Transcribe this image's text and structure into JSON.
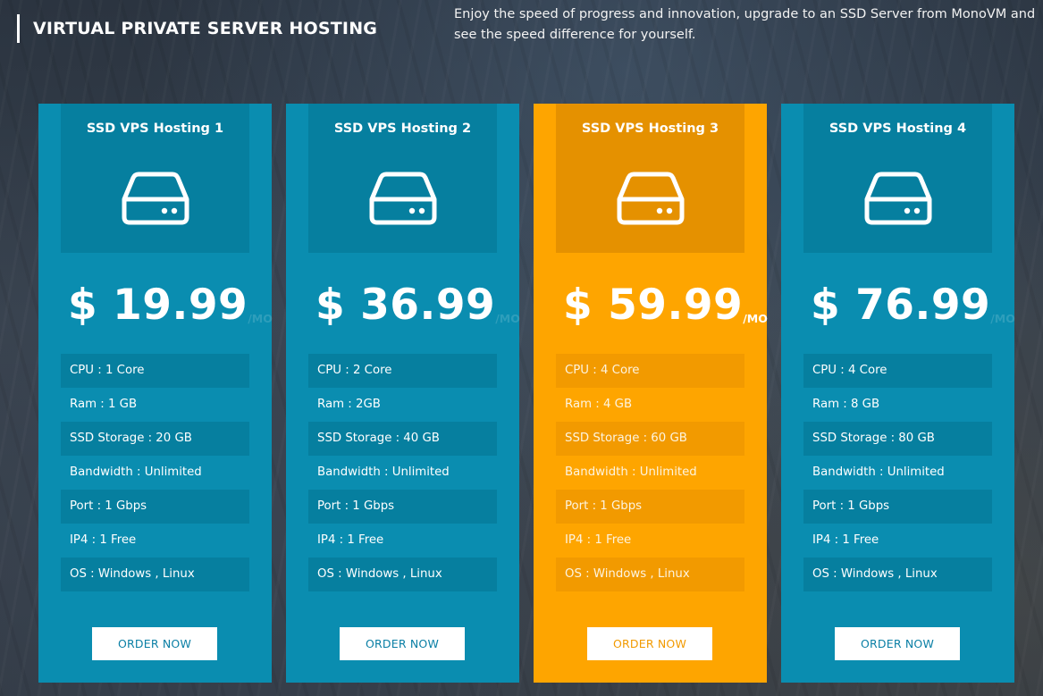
{
  "section": {
    "title": "VIRTUAL PRIVATE SERVER HOSTING",
    "intro": "Enjoy the speed of progress and innovation, upgrade to an SSD Server from MonoVM and see the speed difference for yourself."
  },
  "colors": {
    "plan_blue": "#0a8db0",
    "plan_blue_dark": "#067f9f",
    "featured_orange": "#fea500",
    "featured_orange_dark": "#e59100"
  },
  "plans": [
    {
      "name": "SSD VPS Hosting 1",
      "icon": "hard-drive-icon",
      "price": "$ 19.99",
      "per": "/MO",
      "featured": false,
      "features": [
        "CPU : 1 Core",
        "Ram : 1 GB",
        "SSD Storage : 20 GB",
        "Bandwidth : Unlimited",
        "Port : 1 Gbps",
        "IP4 : 1 Free",
        "OS : Windows , Linux"
      ],
      "button": "ORDER NOW"
    },
    {
      "name": "SSD VPS Hosting 2",
      "icon": "hard-drive-icon",
      "price": "$ 36.99",
      "per": "/MO",
      "featured": false,
      "features": [
        "CPU : 2 Core",
        "Ram : 2GB",
        "SSD Storage : 40 GB",
        "Bandwidth : Unlimited",
        "Port : 1 Gbps",
        "IP4 : 1 Free",
        "OS : Windows , Linux"
      ],
      "button": "ORDER NOW"
    },
    {
      "name": "SSD VPS Hosting 3",
      "icon": "hard-drive-icon",
      "price": "$ 59.99",
      "per": "/MO",
      "featured": true,
      "features": [
        "CPU : 4 Core",
        "Ram : 4 GB",
        "SSD Storage : 60 GB",
        "Bandwidth : Unlimited",
        "Port : 1 Gbps",
        "IP4 : 1 Free",
        "OS : Windows , Linux"
      ],
      "button": "ORDER NOW"
    },
    {
      "name": "SSD VPS Hosting 4",
      "icon": "hard-drive-icon",
      "price": "$ 76.99",
      "per": "/MO",
      "featured": false,
      "features": [
        "CPU : 4 Core",
        "Ram : 8 GB",
        "SSD Storage : 80 GB",
        "Bandwidth : Unlimited",
        "Port : 1 Gbps",
        "IP4 : 1 Free",
        "OS : Windows , Linux"
      ],
      "button": "ORDER NOW"
    }
  ]
}
